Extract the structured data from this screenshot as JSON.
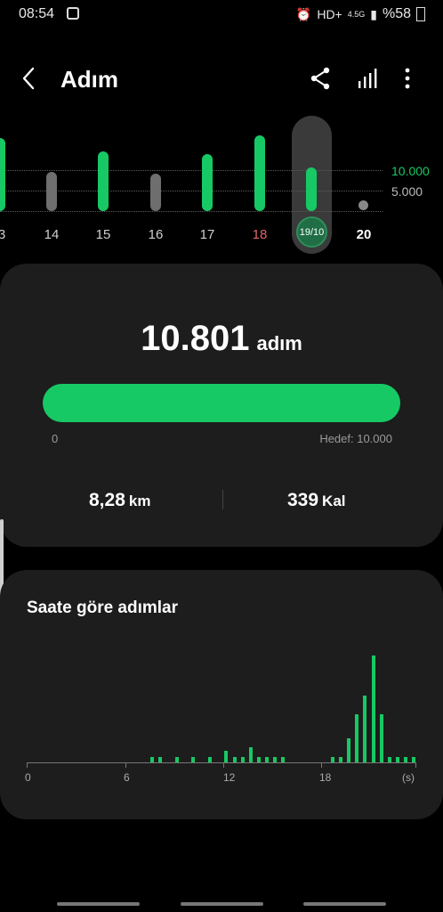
{
  "status": {
    "time": "08:54",
    "network": "HD+",
    "network_type": "4.5G",
    "battery": "%58"
  },
  "header": {
    "title": "Adım"
  },
  "week_chart": {
    "days": [
      "3",
      "14",
      "15",
      "16",
      "17",
      "18",
      "19/10",
      "20"
    ],
    "goal_label": "10.000",
    "half_label": "5.000",
    "selected": "19/10"
  },
  "summary": {
    "steps_value": "10.801",
    "steps_unit": "adım",
    "progress_start": "0",
    "goal_text": "Hedef: 10.000",
    "progress_fraction": 1.0,
    "distance_value": "8,28",
    "distance_unit": "km",
    "calories_value": "339",
    "calories_unit": "Kal"
  },
  "hourly": {
    "title": "Saate göre adımlar",
    "ticks": [
      "0",
      "6",
      "12",
      "18",
      "(s)"
    ]
  },
  "colors": {
    "accent": "#17c964",
    "card": "#1d1d1d",
    "weekend": "#e06666"
  }
}
